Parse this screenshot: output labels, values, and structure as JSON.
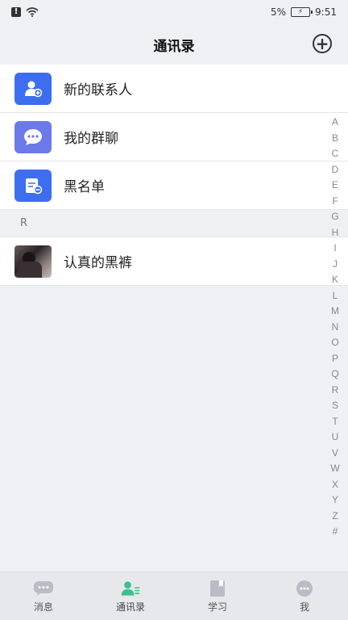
{
  "status": {
    "battery_percent": "5%",
    "time": "9:51"
  },
  "header": {
    "title": "通讯录"
  },
  "quick_items": [
    {
      "label": "新的联系人",
      "icon": "add-contact-icon"
    },
    {
      "label": "我的群聊",
      "icon": "group-chat-icon"
    },
    {
      "label": "黑名单",
      "icon": "blacklist-icon"
    }
  ],
  "section": {
    "letter": "R"
  },
  "contacts": [
    {
      "name": "认真的黑裤"
    }
  ],
  "index": [
    "A",
    "B",
    "C",
    "D",
    "E",
    "F",
    "G",
    "H",
    "I",
    "J",
    "K",
    "L",
    "M",
    "N",
    "O",
    "P",
    "Q",
    "R",
    "S",
    "T",
    "U",
    "V",
    "W",
    "X",
    "Y",
    "Z",
    "#"
  ],
  "tabs": [
    {
      "label": "消息",
      "icon": "message-icon",
      "active": false
    },
    {
      "label": "通讯录",
      "icon": "contacts-icon",
      "active": true
    },
    {
      "label": "学习",
      "icon": "book-icon",
      "active": false
    },
    {
      "label": "我",
      "icon": "profile-icon",
      "active": false
    }
  ],
  "colors": {
    "accent_blue": "#3d6ef0",
    "accent_purple": "#6b7ae8",
    "active_tab_green": "#3cbf8a",
    "inactive_tab_gray": "#b8bcc4"
  }
}
